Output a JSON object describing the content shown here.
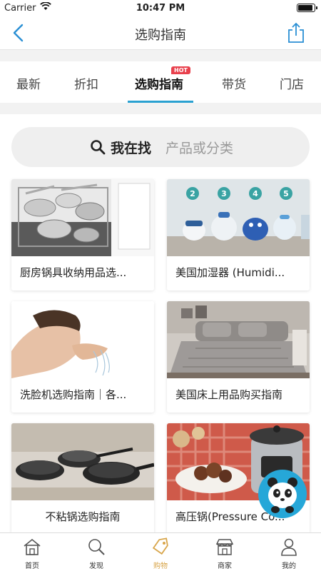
{
  "status": {
    "carrier": "Carrier",
    "time": "10:47 PM",
    "battery_level": 0.9
  },
  "navbar": {
    "title": "选购指南",
    "back_icon": "chevron-left-icon",
    "share_icon": "share-icon",
    "accent": "#2a8fd4"
  },
  "tabs": [
    {
      "label": "最新",
      "active": false
    },
    {
      "label": "折扣",
      "active": false
    },
    {
      "label": "选购指南",
      "active": true,
      "badge": "HOT"
    },
    {
      "label": "带货",
      "active": false
    },
    {
      "label": "门店",
      "active": false
    }
  ],
  "search": {
    "label": "我在找",
    "placeholder": "产品或分类",
    "icon": "search-icon"
  },
  "guides": [
    {
      "title": "厨房锅具收纳用品选...",
      "image": "kitchen-cookware-organizer"
    },
    {
      "title": "美国加湿器 (Humidi...",
      "image": "humidifiers-lineup",
      "numbers": [
        "2",
        "3",
        "4",
        "5"
      ]
    },
    {
      "title": "洗脸机选购指南｜各...",
      "image": "woman-washing-face"
    },
    {
      "title": "美国床上用品购买指南",
      "image": "gray-bedding"
    },
    {
      "title": "不粘锅选购指南",
      "image": "nonstick-pans"
    },
    {
      "title": "高压锅(Pressure Co...",
      "image": "pressure-cooker"
    }
  ],
  "bottom_nav": [
    {
      "label": "首页",
      "icon": "home-icon",
      "active": false
    },
    {
      "label": "发现",
      "icon": "search-icon",
      "active": false
    },
    {
      "label": "购物",
      "icon": "shopping-tag-icon",
      "active": true
    },
    {
      "label": "商家",
      "icon": "store-icon",
      "active": false
    },
    {
      "label": "我的",
      "icon": "user-icon",
      "active": false
    }
  ],
  "colors": {
    "active_tab_underline": "#2aa1d1",
    "hot_badge": "#e8404c",
    "bottom_active": "#d8a54a",
    "panda_bg": "#26a7d8"
  }
}
